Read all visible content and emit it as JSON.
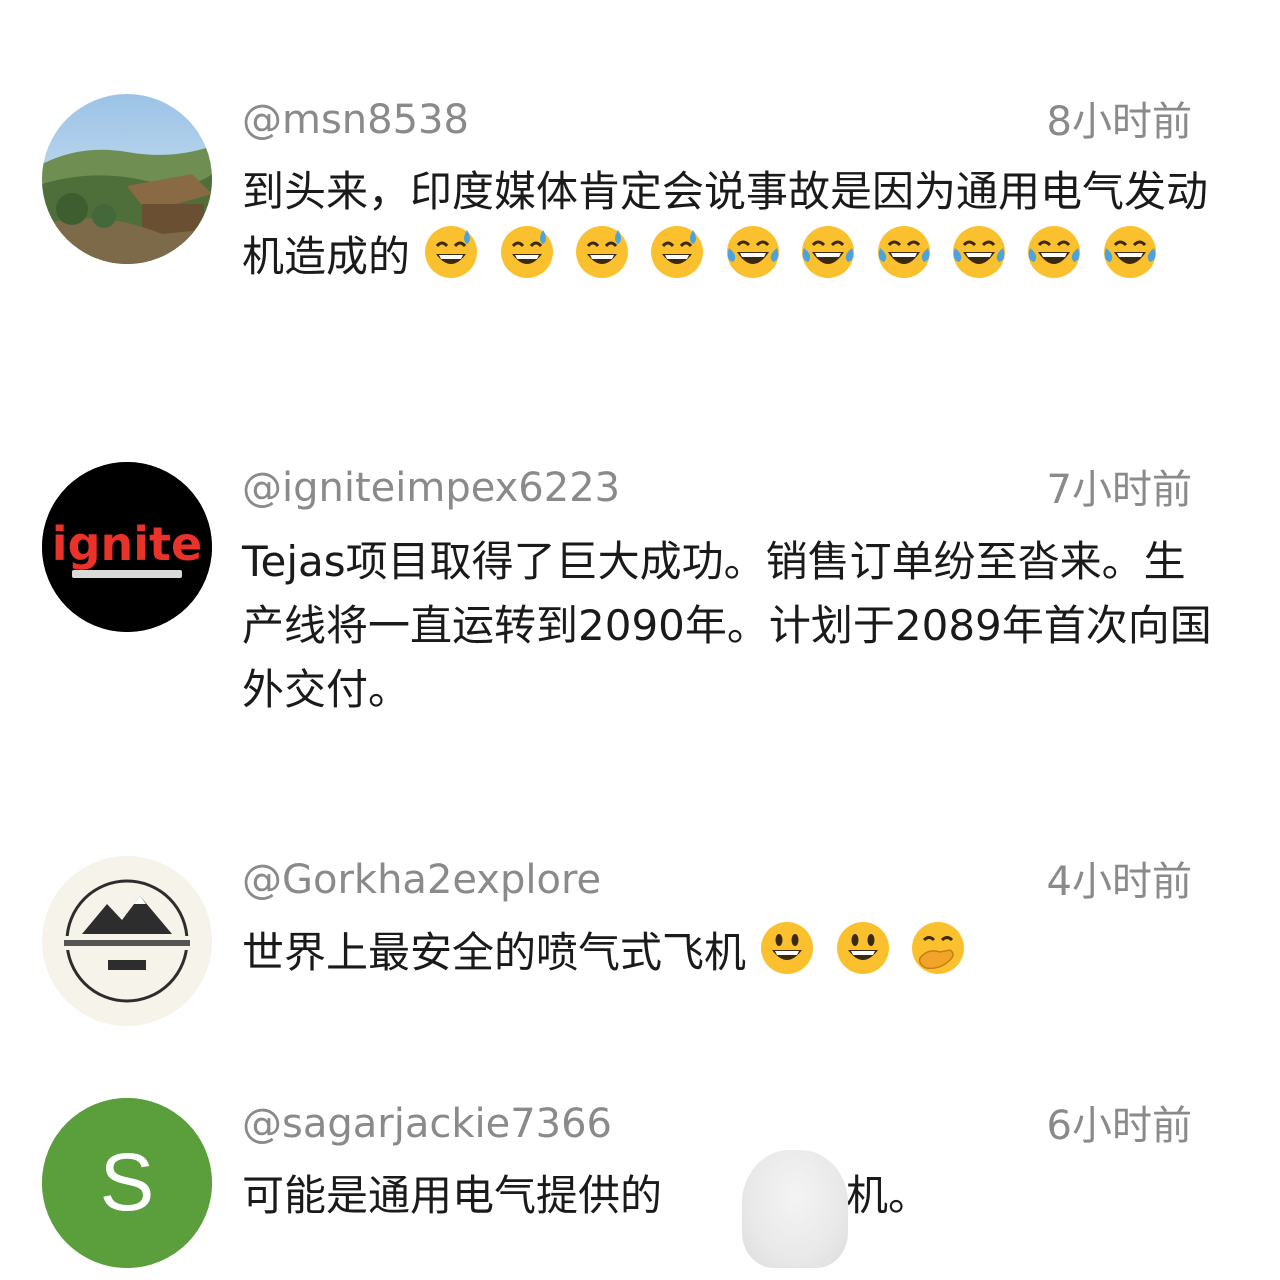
{
  "comments": [
    {
      "username": "@msn8538",
      "time": "8小时前",
      "text": "到头来，印度媒体肯定会说事故是因为通用电气发动机造成的",
      "emojis": [
        "grinning-sweat",
        "grinning-sweat",
        "grinning-sweat",
        "grinning-sweat",
        "tears-of-joy",
        "tears-of-joy",
        "tears-of-joy",
        "tears-of-joy",
        "tears-of-joy",
        "tears-of-joy"
      ],
      "avatar": "landscape-photo-avatar"
    },
    {
      "username": "@igniteimpex6223",
      "time": "7小时前",
      "text": "Tejas项目取得了巨大成功。销售订单纷至沓来。生产线将一直运转到2090年。计划于2089年首次向国外交付。",
      "emojis": [],
      "avatar": "ignite-logo-avatar",
      "avatar_logo_text": "ignite"
    },
    {
      "username": "@Gorkha2explore",
      "time": "4小时前",
      "text": "世界上最安全的喷气式飞机",
      "emojis": [
        "smiley",
        "smiley",
        "hand-over-mouth"
      ],
      "avatar": "mountain-badge-avatar"
    },
    {
      "username": "@sagarjackie7366",
      "time": "6小时前",
      "text_before": "可能是通用电气提供的",
      "text_after": "发动机。",
      "emojis": [],
      "avatar": "letter-avatar",
      "avatar_letter": "S",
      "avatar_color": "#5b9e3c"
    }
  ],
  "colors": {
    "meta_text": "#8a8a8a",
    "body_text": "#1a1a1a",
    "emoji_yellow": "#fbc02d",
    "sweat_blue": "#4aa3df"
  }
}
